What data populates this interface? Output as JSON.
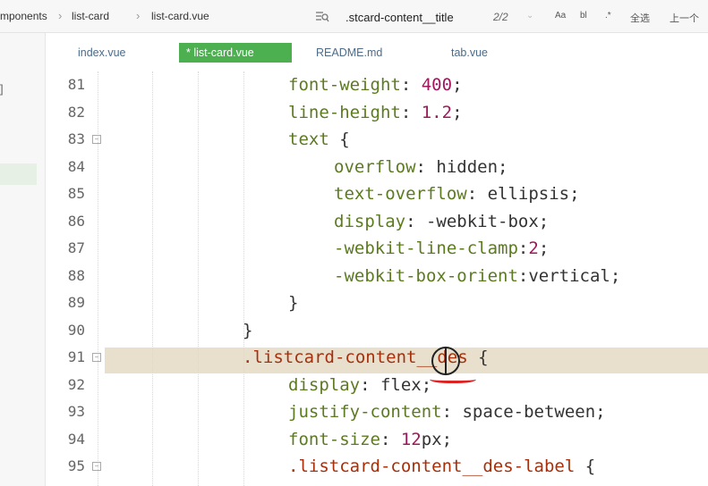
{
  "breadcrumb": {
    "items": [
      "mponents",
      "list-card",
      "list-card.vue"
    ]
  },
  "find": {
    "query": ".stcard-content__title",
    "count": "2/2",
    "case_label": "Aa",
    "word_label": "bl",
    "regex_label": ".*",
    "select_all_label": "全选",
    "prev_label": "上一个"
  },
  "tabs": [
    {
      "label": "index.vue",
      "active": false
    },
    {
      "label": "* list-card.vue",
      "active": true
    },
    {
      "label": "README.md",
      "active": false
    },
    {
      "label": "tab.vue",
      "active": false
    }
  ],
  "sidebar": {
    "bracket": "]"
  },
  "editor": {
    "lines": [
      {
        "num": "81",
        "fold": false,
        "parts": [
          {
            "t": "font-weight",
            "c": "prop"
          },
          {
            "t": ": ",
            "c": ""
          },
          {
            "t": "400",
            "c": "num"
          },
          {
            "t": ";",
            "c": ""
          }
        ]
      },
      {
        "num": "82",
        "fold": false,
        "parts": [
          {
            "t": "line-height",
            "c": "prop"
          },
          {
            "t": ": ",
            "c": ""
          },
          {
            "t": "1.2",
            "c": "num"
          },
          {
            "t": ";",
            "c": ""
          }
        ]
      },
      {
        "num": "83",
        "fold": true,
        "parts": [
          {
            "t": "text",
            "c": "prop"
          },
          {
            "t": " {",
            "c": ""
          }
        ]
      },
      {
        "num": "84",
        "fold": false,
        "parts": [
          {
            "t": "overflow",
            "c": "prop"
          },
          {
            "t": ": hidden;",
            "c": ""
          }
        ]
      },
      {
        "num": "85",
        "fold": false,
        "parts": [
          {
            "t": "text-overflow",
            "c": "prop"
          },
          {
            "t": ": ellipsis;",
            "c": ""
          }
        ]
      },
      {
        "num": "86",
        "fold": false,
        "parts": [
          {
            "t": "display",
            "c": "prop"
          },
          {
            "t": ": -webkit-box;",
            "c": ""
          }
        ]
      },
      {
        "num": "87",
        "fold": false,
        "parts": [
          {
            "t": "-webkit-line-clamp",
            "c": "prop"
          },
          {
            "t": ":",
            "c": ""
          },
          {
            "t": "2",
            "c": "num"
          },
          {
            "t": ";",
            "c": ""
          }
        ]
      },
      {
        "num": "88",
        "fold": false,
        "parts": [
          {
            "t": "-webkit-box-orient",
            "c": "prop"
          },
          {
            "t": ":vertical;",
            "c": ""
          }
        ]
      },
      {
        "num": "89",
        "fold": false,
        "parts": [
          {
            "t": "}",
            "c": ""
          }
        ]
      },
      {
        "num": "90",
        "fold": false,
        "parts": [
          {
            "t": "}",
            "c": ""
          }
        ]
      },
      {
        "num": "91",
        "fold": true,
        "parts": [
          {
            "t": ".listcard-content__des",
            "c": "sel"
          },
          {
            "t": " {",
            "c": ""
          }
        ]
      },
      {
        "num": "92",
        "fold": false,
        "parts": [
          {
            "t": "display",
            "c": "prop"
          },
          {
            "t": ": flex;",
            "c": ""
          }
        ]
      },
      {
        "num": "93",
        "fold": false,
        "parts": [
          {
            "t": "justify-content",
            "c": "prop"
          },
          {
            "t": ": space-between;",
            "c": ""
          }
        ]
      },
      {
        "num": "94",
        "fold": false,
        "parts": [
          {
            "t": "font-size",
            "c": "prop"
          },
          {
            "t": ": ",
            "c": ""
          },
          {
            "t": "12",
            "c": "num"
          },
          {
            "t": "px;",
            "c": ""
          }
        ]
      },
      {
        "num": "95",
        "fold": true,
        "parts": [
          {
            "t": ".listcard-content__des-label",
            "c": "sel"
          },
          {
            "t": " {",
            "c": ""
          }
        ]
      }
    ]
  },
  "colors": {
    "property": "#5c7a1f",
    "number": "#a0185c",
    "selector": "#a6300c",
    "active_tab": "#4caf50",
    "current_line": "#e8dfcd"
  }
}
